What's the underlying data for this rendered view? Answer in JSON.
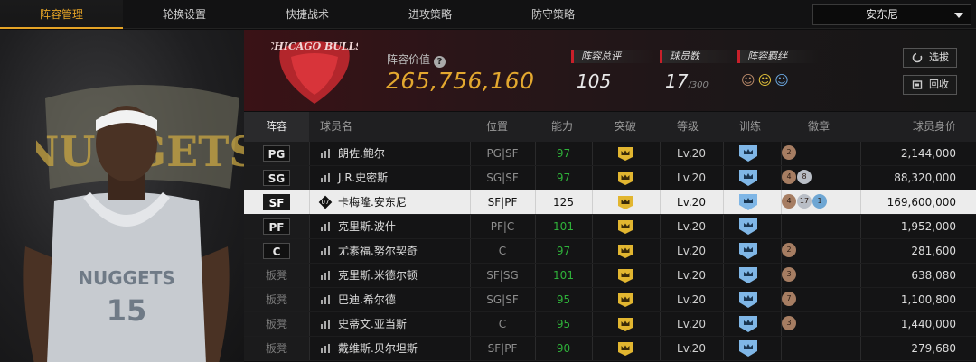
{
  "nav": {
    "tabs": [
      {
        "label": "阵容管理",
        "active": true
      },
      {
        "label": "轮换设置",
        "active": false
      },
      {
        "label": "快捷战术",
        "active": false
      },
      {
        "label": "进攻策略",
        "active": false
      },
      {
        "label": "防守策略",
        "active": false
      }
    ],
    "team_select": "安东尼"
  },
  "header": {
    "value_label": "阵容价值",
    "value": "265,756,160",
    "stats": {
      "rating_label": "阵容总评",
      "rating": "105",
      "players_label": "球员数",
      "players": "17",
      "players_max": "/300",
      "chem_label": "阵容羁绊"
    },
    "buttons": {
      "pick": "选拔",
      "recycle": "回收"
    },
    "accent_color": "#e3a82f",
    "positive_color": "#2fb23a"
  },
  "table": {
    "headers": {
      "lineup": "阵容",
      "name": "球员名",
      "position": "位置",
      "ability": "能力",
      "breakthrough": "突破",
      "level": "等级",
      "training": "训练",
      "badges": "徽章",
      "salary": "球员身价"
    },
    "rows": [
      {
        "slot": "PG",
        "bench": false,
        "jersey": "",
        "name": "朗佐.鲍尔",
        "position": "PG|SF",
        "ability": "97",
        "level": "Lv.20",
        "badges": [
          {
            "n": "2",
            "c": "bronze"
          }
        ],
        "salary": "2,144,000",
        "selected": false
      },
      {
        "slot": "SG",
        "bench": false,
        "jersey": "",
        "name": "J.R.史密斯",
        "position": "SG|SF",
        "ability": "97",
        "level": "Lv.20",
        "badges": [
          {
            "n": "4",
            "c": "bronze"
          },
          {
            "n": "8",
            "c": "silver"
          }
        ],
        "salary": "88,320,000",
        "selected": false
      },
      {
        "slot": "SF",
        "bench": false,
        "jersey": "07",
        "name": "卡梅隆.安东尼",
        "position": "SF|PF",
        "ability": "125",
        "level": "Lv.20",
        "badges": [
          {
            "n": "4",
            "c": "bronze"
          },
          {
            "n": "17",
            "c": "silver"
          },
          {
            "n": "1",
            "c": "blue"
          }
        ],
        "salary": "169,600,000",
        "selected": true
      },
      {
        "slot": "PF",
        "bench": false,
        "jersey": "",
        "name": "克里斯.波什",
        "position": "PF|C",
        "ability": "101",
        "level": "Lv.20",
        "badges": [],
        "salary": "1,952,000",
        "selected": false
      },
      {
        "slot": "C",
        "bench": false,
        "jersey": "",
        "name": "尤素福.努尔契奇",
        "position": "C",
        "ability": "97",
        "level": "Lv.20",
        "badges": [
          {
            "n": "2",
            "c": "bronze"
          }
        ],
        "salary": "281,600",
        "selected": false
      },
      {
        "slot": "板凳",
        "bench": true,
        "jersey": "",
        "name": "克里斯.米德尔顿",
        "position": "SF|SG",
        "ability": "101",
        "level": "Lv.20",
        "badges": [
          {
            "n": "3",
            "c": "bronze"
          }
        ],
        "salary": "638,080",
        "selected": false
      },
      {
        "slot": "板凳",
        "bench": true,
        "jersey": "",
        "name": "巴迪.希尔德",
        "position": "SG|SF",
        "ability": "95",
        "level": "Lv.20",
        "badges": [
          {
            "n": "7",
            "c": "bronze"
          }
        ],
        "salary": "1,100,800",
        "selected": false
      },
      {
        "slot": "板凳",
        "bench": true,
        "jersey": "",
        "name": "史蒂文.亚当斯",
        "position": "C",
        "ability": "95",
        "level": "Lv.20",
        "badges": [
          {
            "n": "3",
            "c": "bronze"
          }
        ],
        "salary": "1,440,000",
        "selected": false
      },
      {
        "slot": "板凳",
        "bench": true,
        "jersey": "",
        "name": "戴维斯.贝尔坦斯",
        "position": "SF|PF",
        "ability": "90",
        "level": "Lv.20",
        "badges": [],
        "salary": "279,680",
        "selected": false
      }
    ]
  },
  "left_panel": {
    "logo_text": "NUGGETS",
    "jersey_text": "NUGGETS",
    "jersey_number": "15"
  },
  "header_logo_text": "CHICAGO BULLS"
}
